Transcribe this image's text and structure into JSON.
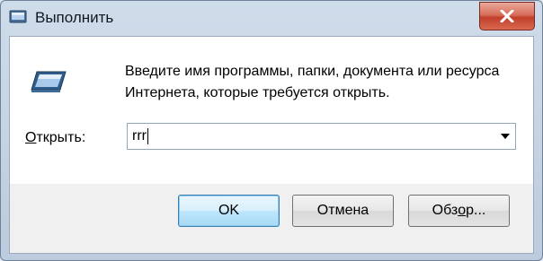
{
  "window": {
    "title": "Выполнить",
    "title_icon": "run-icon",
    "close_icon": "close-icon"
  },
  "description": {
    "line1": "Введите имя программы, папки, документа или ресурса",
    "line2": "Интернета, которые требуется открыть."
  },
  "open_field": {
    "label_underlined": "О",
    "label_rest": "ткрыть:",
    "value": "rrr"
  },
  "buttons": {
    "ok": "OK",
    "cancel": "Отмена",
    "browse_pre": "Обз",
    "browse_underlined": "о",
    "browse_post": "р..."
  },
  "colors": {
    "accent": "#3c7fb1",
    "close": "#c2402c"
  }
}
